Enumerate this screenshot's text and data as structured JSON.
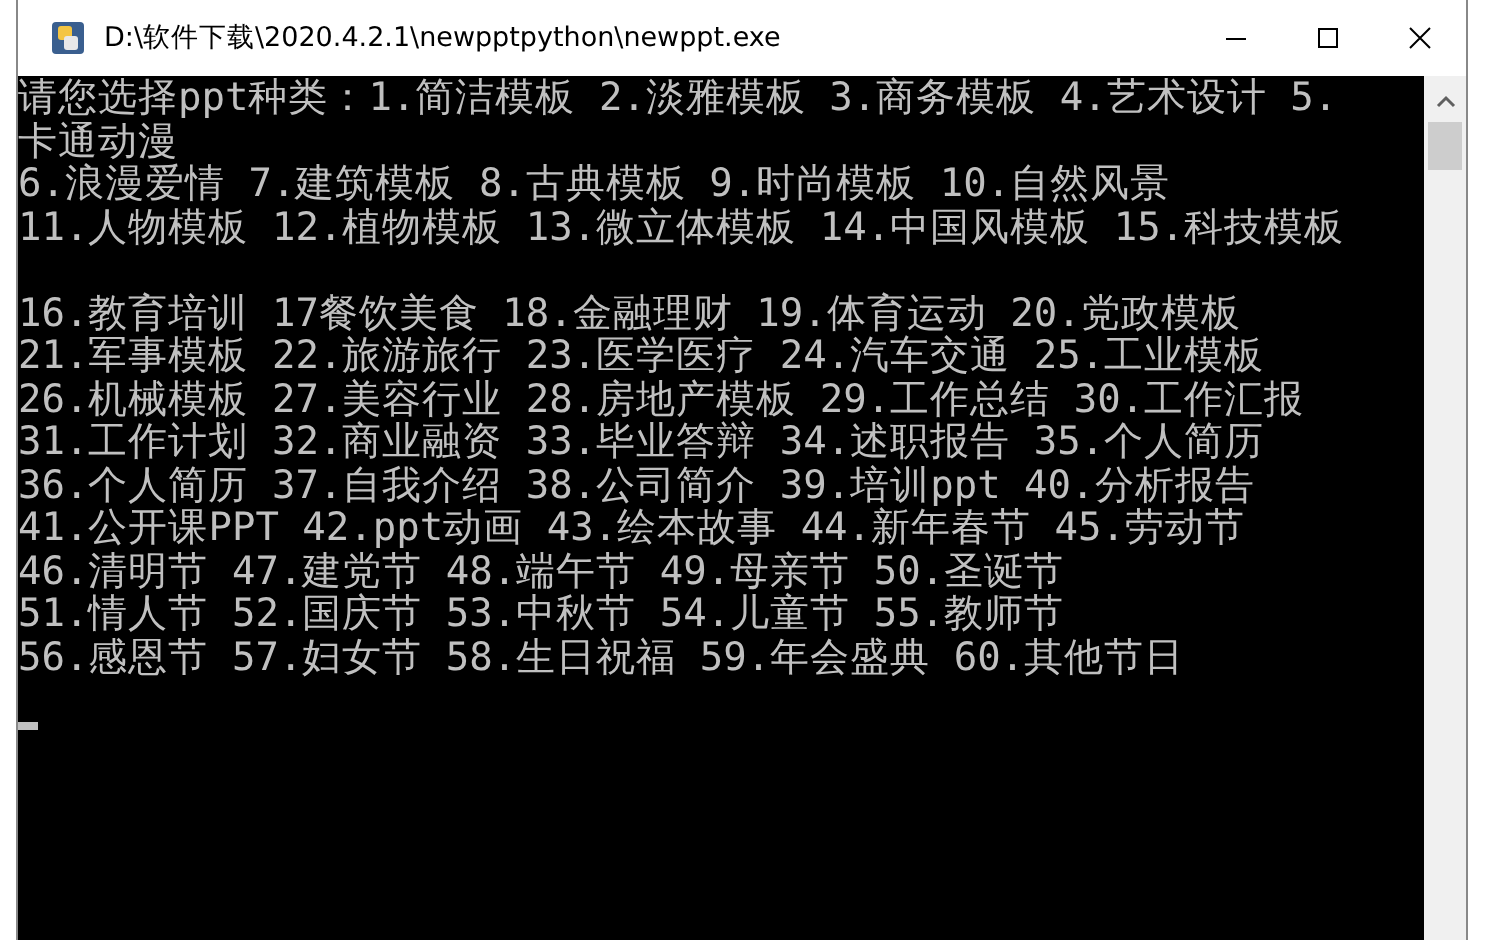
{
  "window": {
    "title": "D:\\软件下载\\2020.4.2.1\\newpptpython\\newppt.exe"
  },
  "console": {
    "blocks": [
      [
        "请您选择ppt种类：1.简洁模板 2.淡雅模板 3.商务模板 4.艺术设计 5.",
        "卡通动漫",
        "6.浪漫爱情 7.建筑模板 8.古典模板 9.时尚模板 10.自然风景",
        "11.人物模板 12.植物模板 13.微立体模板 14.中国风模板 15.科技模板"
      ],
      [
        "16.教育培训 17餐饮美食 18.金融理财 19.体育运动 20.党政模板",
        "21.军事模板 22.旅游旅行 23.医学医疗 24.汽车交通 25.工业模板",
        "26.机械模板 27.美容行业 28.房地产模板 29.工作总结 30.工作汇报",
        "31.工作计划 32.商业融资 33.毕业答辩 34.述职报告 35.个人简历",
        "36.个人简历 37.自我介绍 38.公司简介 39.培训ppt 40.分析报告",
        "41.公开课PPT 42.ppt动画 43.绘本故事 44.新年春节 45.劳动节",
        "46.清明节 47.建党节 48.端午节 49.母亲节 50.圣诞节",
        "51.情人节 52.国庆节 53.中秋节 54.儿童节 55.教师节",
        "56.感恩节 57.妇女节 58.生日祝福 59.年会盛典 60.其他节日"
      ]
    ]
  }
}
